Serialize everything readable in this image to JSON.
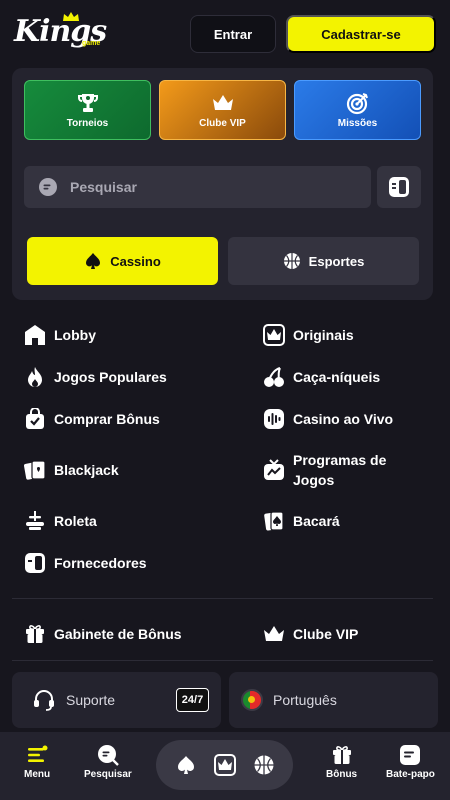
{
  "header": {
    "logo_text": "Kings",
    "logo_sub": "game",
    "login_label": "Entrar",
    "register_label": "Cadastrar-se"
  },
  "promos": [
    {
      "label": "Torneios",
      "icon": "trophy-icon"
    },
    {
      "label": "Clube VIP",
      "icon": "crown-icon"
    },
    {
      "label": "Missões",
      "icon": "target-icon"
    }
  ],
  "search": {
    "placeholder": "Pesquisar"
  },
  "tabs": [
    {
      "label": "Cassino",
      "icon": "spade-icon",
      "active": true
    },
    {
      "label": "Esportes",
      "icon": "basketball-icon",
      "active": false
    }
  ],
  "menu": {
    "left": [
      {
        "label": "Lobby",
        "icon": "home-icon"
      },
      {
        "label": "Jogos Populares",
        "icon": "fire-icon"
      },
      {
        "label": "Comprar Bônus",
        "icon": "shopping-bag-icon"
      },
      {
        "label": "Blackjack",
        "icon": "cards-icon"
      },
      {
        "label": "Roleta",
        "icon": "roulette-icon"
      },
      {
        "label": "Fornecedores",
        "icon": "providers-icon"
      }
    ],
    "right": [
      {
        "label": "Originais",
        "icon": "crown-box-icon"
      },
      {
        "label": "Caça-níqueis",
        "icon": "cherry-icon"
      },
      {
        "label": "Casino ao Vivo",
        "icon": "live-icon"
      },
      {
        "label": "Programas de Jogos",
        "icon": "tv-icon"
      },
      {
        "label": "Bacará",
        "icon": "card-spade-icon"
      }
    ]
  },
  "extras": [
    {
      "label": "Gabinete de Bônus",
      "icon": "gift-icon"
    },
    {
      "label": "Clube VIP",
      "icon": "crown-icon"
    }
  ],
  "support": {
    "label": "Suporte",
    "badge": "24/7"
  },
  "language": {
    "label": "Português"
  },
  "bottom_nav": {
    "menu": "Menu",
    "search": "Pesquisar",
    "bonus": "Bônus",
    "chat": "Bate-papo"
  },
  "colors": {
    "accent": "#f3f300",
    "background": "#17161e",
    "panel": "#24232e"
  }
}
